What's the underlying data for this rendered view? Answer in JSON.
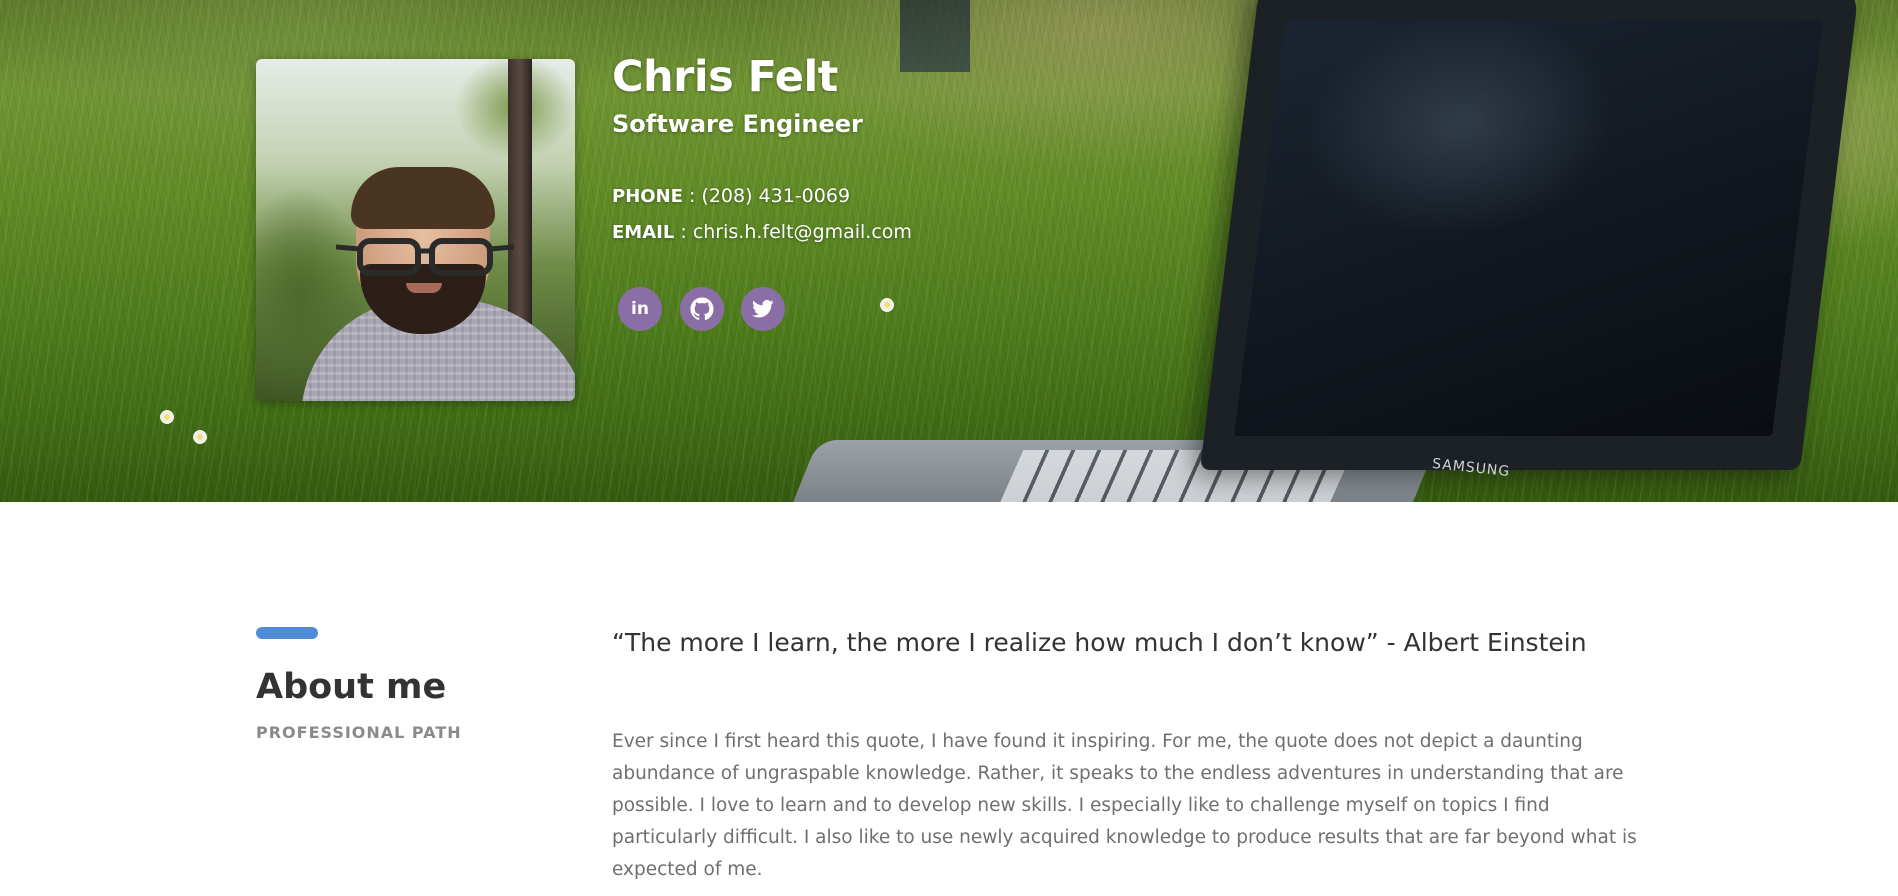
{
  "profile": {
    "name": "Chris Felt",
    "title": "Software Engineer",
    "phone_label": "PHONE",
    "phone": "(208) 431-0069",
    "email_label": "EMAIL",
    "email": "chris.h.felt@gmail.com"
  },
  "social": [
    {
      "name": "linkedin",
      "icon": "linkedin-icon",
      "glyph": "in"
    },
    {
      "name": "github",
      "icon": "github-icon"
    },
    {
      "name": "twitter",
      "icon": "twitter-icon"
    }
  ],
  "hero": {
    "laptop_brand": "SAMSUNG"
  },
  "about": {
    "heading": "About me",
    "subheading": "PROFESSIONAL PATH",
    "quote": "“The more I learn, the more I realize how much I don’t know” - Albert Einstein",
    "bio": "Ever since I first heard this quote, I have found it inspiring. For me, the quote does not depict a daunting abundance of ungraspable knowledge. Rather, it speaks to the endless adventures in understanding that are possible. I love to learn and to develop new skills. I especially like to challenge myself on topics I find particularly difficult. I also like to use newly acquired knowledge to produce results that are far beyond what is expected of me."
  },
  "colors": {
    "accent_bar": "#4f8bd6",
    "social_button": "#8a6ea6",
    "heading_text": "#333333",
    "muted_text": "#6f6f6f"
  }
}
